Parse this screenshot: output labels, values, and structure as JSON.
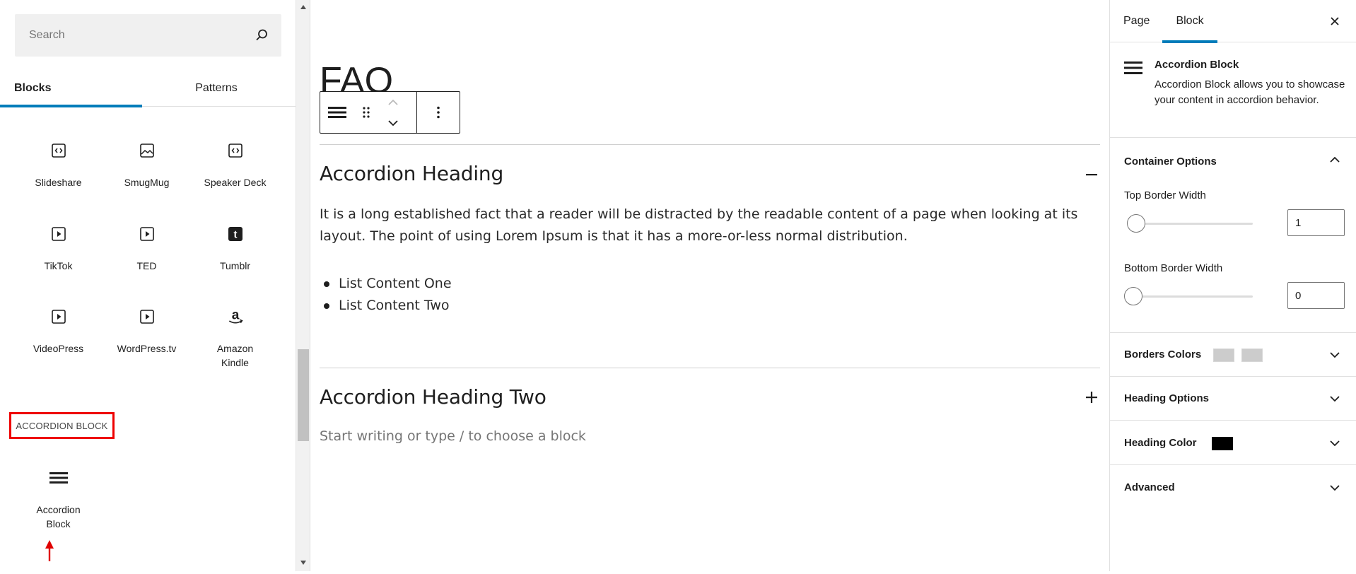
{
  "inserter": {
    "search_placeholder": "Search",
    "tabs": [
      "Blocks",
      "Patterns"
    ],
    "blocks": [
      {
        "label": "Slideshare",
        "icon": "embed-icon"
      },
      {
        "label": "SmugMug",
        "icon": "image-icon"
      },
      {
        "label": "Speaker Deck",
        "icon": "embed-icon"
      },
      {
        "label": "TikTok",
        "icon": "video-icon"
      },
      {
        "label": "TED",
        "icon": "video-icon"
      },
      {
        "label": "Tumblr",
        "icon": "tumblr-icon"
      },
      {
        "label": "VideoPress",
        "icon": "video-icon"
      },
      {
        "label": "WordPress.tv",
        "icon": "video-icon"
      },
      {
        "label": "Amazon Kindle",
        "icon": "amazon-icon"
      }
    ],
    "category_label": "ACCORDION BLOCK",
    "accordion_block_label": "Accordion Block"
  },
  "canvas": {
    "page_title": "FAQ",
    "accordions": [
      {
        "heading": "Accordion Heading",
        "state": "expanded",
        "body": "It is a long established fact that a reader will be distracted by the readable content of a page when looking at its layout. The point of using Lorem Ipsum is that it has a more-or-less normal distribution.",
        "list": [
          "List Content One",
          "List Content Two"
        ]
      },
      {
        "heading": "Accordion Heading Two",
        "state": "collapsed",
        "placeholder": "Start writing or type / to choose a block"
      }
    ]
  },
  "sidebar": {
    "tabs": [
      "Page",
      "Block"
    ],
    "active_tab": "Block",
    "block_title": "Accordion Block",
    "block_description": "Accordion Block allows you to showcase your content in accordion behavior.",
    "panels": {
      "container_options": {
        "title": "Container Options",
        "top_border_label": "Top Border Width",
        "top_border_value": "1",
        "bottom_border_label": "Bottom Border Width",
        "bottom_border_value": "0"
      },
      "borders_colors": {
        "title": "Borders Colors",
        "colors": [
          "#cccccc",
          "#cccccc"
        ]
      },
      "heading_options": {
        "title": "Heading Options"
      },
      "heading_color": {
        "title": "Heading Color",
        "color": "#000000"
      },
      "advanced": {
        "title": "Advanced"
      }
    }
  },
  "colors": {
    "accent": "#007cba",
    "highlight": "#e00000"
  }
}
